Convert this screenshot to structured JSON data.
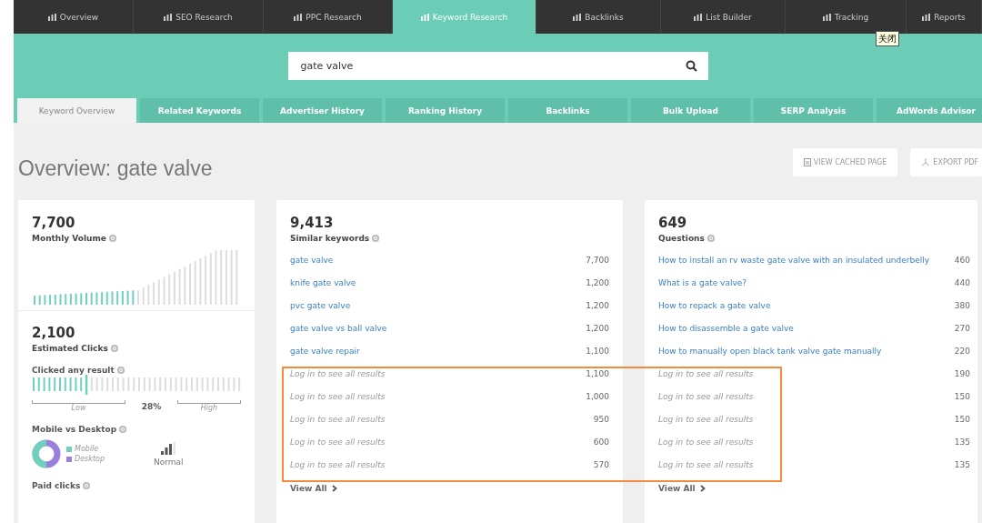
{
  "top_nav": [
    {
      "label": "Overview",
      "selected": false
    },
    {
      "label": "SEO Research",
      "selected": false
    },
    {
      "label": "PPC Research",
      "selected": false
    },
    {
      "label": "Keyword Research",
      "selected": true
    },
    {
      "label": "Backlinks",
      "selected": false
    },
    {
      "label": "List Builder",
      "selected": false
    },
    {
      "label": "Tracking",
      "selected": false
    },
    {
      "label": "Reports",
      "selected": false
    }
  ],
  "tooltip": "关闭",
  "search": {
    "value": "gate valve"
  },
  "sub_tabs": [
    {
      "label": "Keyword Overview",
      "selected": true
    },
    {
      "label": "Related Keywords",
      "selected": false
    },
    {
      "label": "Advertiser History",
      "selected": false
    },
    {
      "label": "Ranking History",
      "selected": false
    },
    {
      "label": "Backlinks",
      "selected": false
    },
    {
      "label": "Bulk Upload",
      "selected": false
    },
    {
      "label": "SERP Analysis",
      "selected": false
    },
    {
      "label": "AdWords Advisor",
      "selected": false
    }
  ],
  "page_title": "Overview: gate valve",
  "actions": [
    "VIEW CACHED PAGE",
    "EXPORT PDF"
  ],
  "summary": {
    "monthly_volume": {
      "value": "7,700",
      "label": "Monthly Volume"
    },
    "estimated_clicks": {
      "value": "2,100",
      "label": "Estimated Clicks"
    },
    "clicked_any": {
      "label": "Clicked any result",
      "level": 0.28,
      "reading": "28%",
      "low": "Low",
      "high": "High"
    },
    "mobile_desktop": {
      "label": "Mobile vs Desktop",
      "legend": [
        "Mobile",
        "Desktop"
      ],
      "signal": "Normal"
    },
    "paid_clicks": {
      "label": "Paid clicks"
    }
  },
  "panels": [
    {
      "count": "9,413",
      "label": "Similar keywords",
      "view_all": "View All",
      "rows": [
        {
          "text": "gate valve",
          "value": "7,700",
          "locked": false
        },
        {
          "text": "knife gate valve",
          "value": "1,200",
          "locked": false
        },
        {
          "text": "pvc gate valve",
          "value": "1,200",
          "locked": false
        },
        {
          "text": "gate valve vs ball valve",
          "value": "1,200",
          "locked": false
        },
        {
          "text": "gate valve repair",
          "value": "1,100",
          "locked": false
        },
        {
          "text": "Log in to see all results",
          "value": "1,100",
          "locked": true
        },
        {
          "text": "Log in to see all results",
          "value": "1,000",
          "locked": true
        },
        {
          "text": "Log in to see all results",
          "value": "950",
          "locked": true
        },
        {
          "text": "Log in to see all results",
          "value": "600",
          "locked": true
        },
        {
          "text": "Log in to see all results",
          "value": "570",
          "locked": true
        }
      ]
    },
    {
      "count": "649",
      "label": "Questions",
      "view_all": "View All",
      "rows": [
        {
          "text": "How to install an rv waste gate valve with an insulated underbelly",
          "value": "460",
          "locked": false
        },
        {
          "text": "What is a gate valve?",
          "value": "440",
          "locked": false
        },
        {
          "text": "How to repack a gate valve",
          "value": "380",
          "locked": false
        },
        {
          "text": "How to disassemble a gate valve",
          "value": "270",
          "locked": false
        },
        {
          "text": "How to manually open black tank valve gate manually",
          "value": "220",
          "locked": false
        },
        {
          "text": "Log in to see all results",
          "value": "190",
          "locked": true
        },
        {
          "text": "Log in to see all results",
          "value": "150",
          "locked": true
        },
        {
          "text": "Log in to see all results",
          "value": "150",
          "locked": true
        },
        {
          "text": "Log in to see all results",
          "value": "135",
          "locked": true
        },
        {
          "text": "Log in to see all results",
          "value": "135",
          "locked": true
        }
      ]
    }
  ]
}
